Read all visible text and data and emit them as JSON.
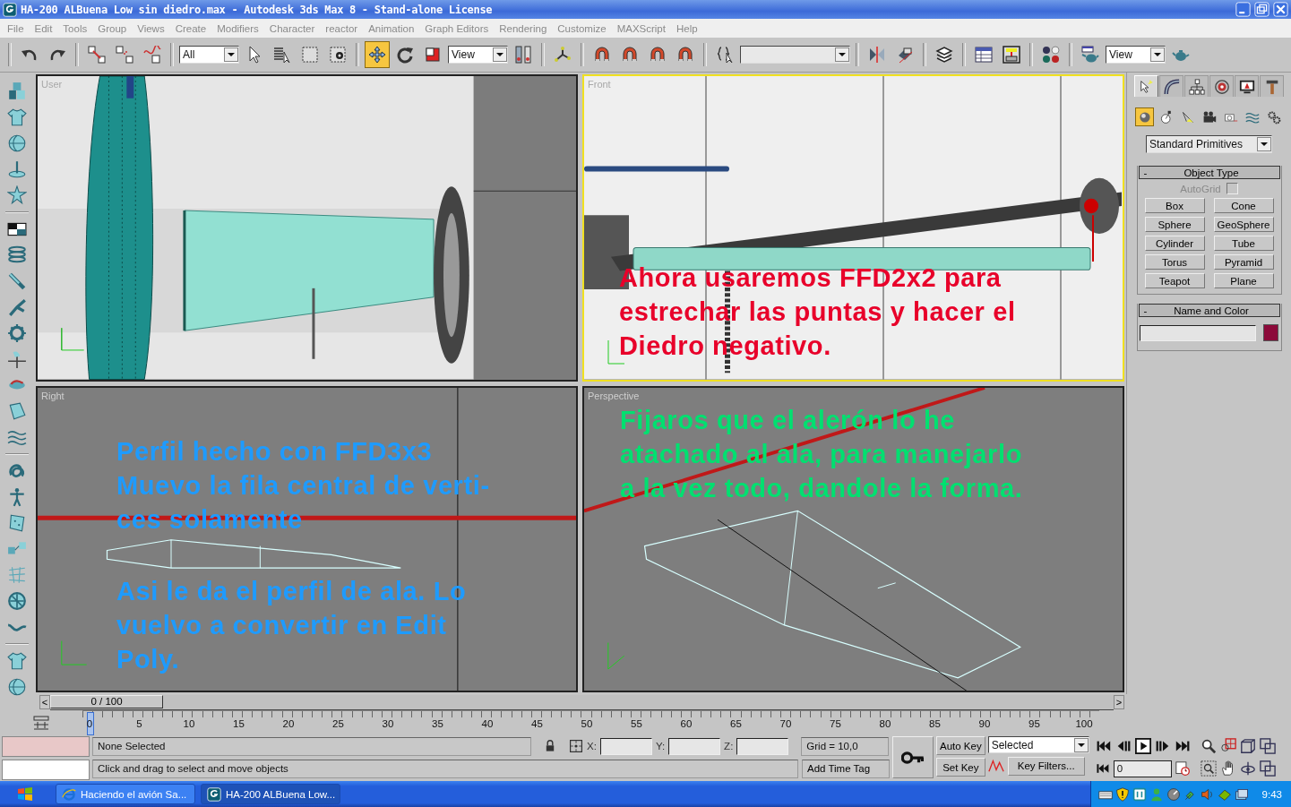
{
  "window": {
    "title": "HA-200 ALBuena Low sin diedro.max - Autodesk 3ds Max 8  - Stand-alone License"
  },
  "menu": [
    "File",
    "Edit",
    "Tools",
    "Group",
    "Views",
    "Create",
    "Modifiers",
    "Character",
    "reactor",
    "Animation",
    "Graph Editors",
    "Rendering",
    "Customize",
    "MAXScript",
    "Help"
  ],
  "toolbar": {
    "dropdowns": [
      "All",
      "View",
      "View"
    ],
    "buttons": [
      {
        "selected": false
      },
      {
        "selected": false
      },
      {
        "selected": false
      },
      {
        "selected": false
      },
      {
        "selected": false
      },
      {
        "selected": false
      },
      {
        "selected": false
      },
      {
        "selected": false
      },
      {
        "selected": false
      },
      {
        "selected": true
      },
      {
        "selected": false
      },
      {
        "selected": false
      },
      {
        "selected": false
      },
      {
        "selected": false
      },
      {
        "selected": false
      },
      {
        "selected": false
      },
      {
        "selected": false
      },
      {
        "selected": false
      },
      {
        "selected": false
      },
      {
        "selected": false
      },
      {
        "selected": false
      },
      {
        "selected": false
      },
      {
        "selected": false
      },
      {
        "selected": false
      },
      {
        "selected": false
      },
      {
        "selected": false
      },
      {
        "selected": false
      }
    ]
  },
  "viewports": [
    {
      "label": "User",
      "kind": "user",
      "selected": false
    },
    {
      "label": "Front",
      "kind": "front",
      "selected": true,
      "notes": [
        {
          "text": "Ahora usaremos FFD2x2 para\nestrechar las puntas y hacer el\nDiedro negativo.",
          "color": "#e8002a"
        }
      ]
    },
    {
      "label": "Right",
      "kind": "right",
      "selected": false,
      "notes": [
        {
          "text": "Perfil hecho con FFD3x3\nMuevo la fila central de verti-\nces solamente",
          "color": "#1e9bff"
        },
        {
          "text": "Asi le da el perfil de ala. Lo\nvuelvo a convertir en Edit\nPoly.",
          "color": "#1e9bff"
        }
      ]
    },
    {
      "label": "Perspective",
      "kind": "perspective",
      "selected": false,
      "notes": [
        {
          "text": "Fijaros que el alerón lo he\natachado al ala, para manejarlo\na la vez todo, dandole la forma.",
          "color": "#00e070"
        }
      ]
    }
  ],
  "command_panel": {
    "tabs": [
      {
        "selected": true
      },
      {
        "selected": false
      },
      {
        "selected": false
      },
      {
        "selected": false
      },
      {
        "selected": false
      },
      {
        "selected": false
      }
    ],
    "categories": [
      {
        "selected": true
      },
      {
        "selected": false
      },
      {
        "selected": false
      },
      {
        "selected": false
      },
      {
        "selected": false
      },
      {
        "selected": false
      },
      {
        "selected": false
      }
    ],
    "object_category": "Standard Primitives",
    "object_type": {
      "toggle": "-",
      "title": "Object Type",
      "autogrid": {
        "label": "AutoGrid",
        "checked": false,
        "disabled": true
      },
      "buttons": [
        "Box",
        "Cone",
        "Sphere",
        "GeoSphere",
        "Cylinder",
        "Tube",
        "Torus",
        "Pyramid",
        "Teapot",
        "Plane"
      ]
    },
    "name_and_color": {
      "toggle": "-",
      "title": "Name and Color",
      "color": "#8c0a3a"
    }
  },
  "time_slider": {
    "prev": "<",
    "position": "0 / 100",
    "next": ">",
    "level": 0
  },
  "track_bar": {
    "ticks": [
      "0",
      "5",
      "10",
      "15",
      "20",
      "25",
      "30",
      "35",
      "40",
      "45",
      "50",
      "55",
      "60",
      "65",
      "70",
      "75",
      "80",
      "85",
      "90",
      "95",
      "100"
    ]
  },
  "status": {
    "selection": "None Selected",
    "prompt": "Click and drag to select and move objects",
    "coords": [
      "X:",
      "Y:",
      "Z:"
    ],
    "grid": "Grid = 10,0",
    "time_tag": "Add Time Tag",
    "auto_key": "Auto Key",
    "set_key": "Set Key",
    "key_mode": "Selected",
    "key_filters": "Key Filters...",
    "frame": "0"
  },
  "taskbar": {
    "tasks": [
      {
        "label": "Haciendo el avión Sa...",
        "selected": false
      },
      {
        "label": "HA-200 ALBuena Low...",
        "selected": true
      }
    ],
    "clock": "9:43"
  }
}
